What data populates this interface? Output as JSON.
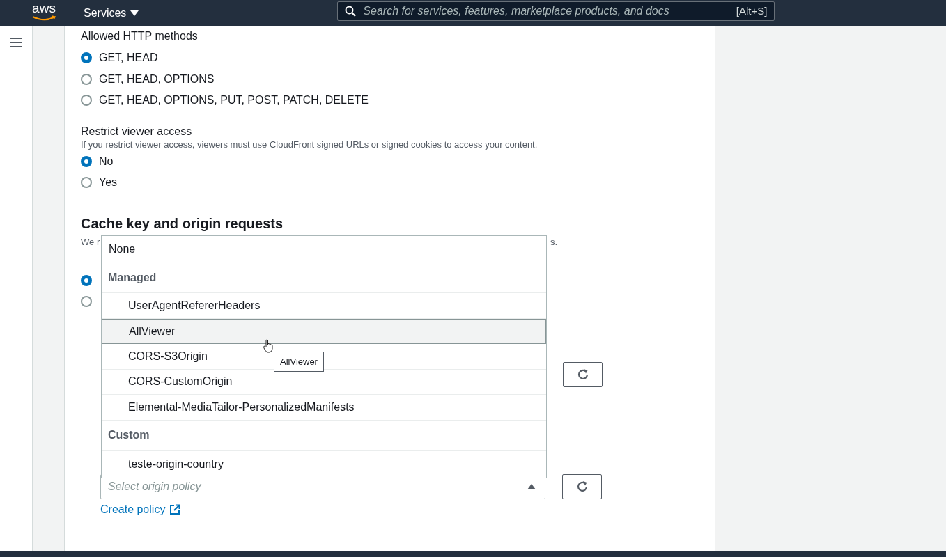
{
  "top_nav": {
    "logo": "aws",
    "services": "Services",
    "search": {
      "placeholder": "Search for services, features, marketplace products, and docs",
      "shortcut": "[Alt+S]"
    }
  },
  "allowed_methods": {
    "label": "Allowed HTTP methods",
    "options": [
      {
        "label": "GET, HEAD",
        "selected": true
      },
      {
        "label": "GET, HEAD, OPTIONS",
        "selected": false
      },
      {
        "label": "GET, HEAD, OPTIONS, PUT, POST, PATCH, DELETE",
        "selected": false
      }
    ]
  },
  "restrict_viewer_access": {
    "label": "Restrict viewer access",
    "description": "If you restrict viewer access, viewers must use CloudFront signed URLs or signed cookies to access your content.",
    "options": [
      {
        "label": "No",
        "selected": true
      },
      {
        "label": "Yes",
        "selected": false
      }
    ]
  },
  "cache_section": {
    "heading": "Cache key and origin requests",
    "description_fragments": [
      "We r",
      "s."
    ],
    "radios": [
      {
        "selected": true
      },
      {
        "selected": false
      }
    ],
    "dropdown": {
      "items": [
        {
          "kind": "option",
          "label": "None",
          "highlighted": false
        },
        {
          "kind": "group",
          "label": "Managed"
        },
        {
          "kind": "option",
          "label": "UserAgentRefererHeaders",
          "highlighted": false
        },
        {
          "kind": "option",
          "label": "AllViewer",
          "highlighted": true
        },
        {
          "kind": "option",
          "label": "CORS-S3Origin",
          "highlighted": false
        },
        {
          "kind": "option",
          "label": "CORS-CustomOrigin",
          "highlighted": false
        },
        {
          "kind": "option",
          "label": "Elemental-MediaTailor-PersonalizedManifests",
          "highlighted": false
        },
        {
          "kind": "group",
          "label": "Custom"
        },
        {
          "kind": "option",
          "label": "teste-origin-country",
          "highlighted": false
        }
      ]
    },
    "tooltip": "AllViewer",
    "origin_select": {
      "placeholder": "Select origin policy",
      "expanded": true
    },
    "create_link": "Create policy"
  }
}
